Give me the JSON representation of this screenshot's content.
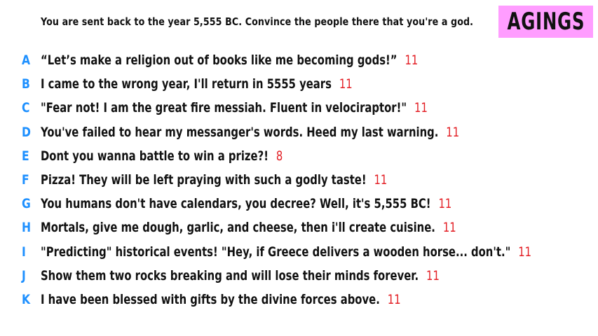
{
  "prompt": "You are sent back to the year 5,555 BC. Convince the people there that you're a god.",
  "badge": "AGINGS",
  "colors": {
    "badge_bg": "#ff9dff",
    "letter": "#1e90ff",
    "score": "#e31e24",
    "text": "#111111"
  },
  "answers": [
    {
      "letter": "A",
      "text": "“Let’s make a religion out of books like me becoming gods!”",
      "score": "11"
    },
    {
      "letter": "B",
      "text": "I came to the wrong year, I'll return in 5555 years",
      "score": "11"
    },
    {
      "letter": "C",
      "text": "\"Fear not! I am the great fire messiah. Fluent in velociraptor!\"",
      "score": "11"
    },
    {
      "letter": "D",
      "text": "You've failed to hear my messanger's words. Heed my last warning.",
      "score": "11"
    },
    {
      "letter": "E",
      "text": "Dont you wanna battle to win a prize?!",
      "score": "8"
    },
    {
      "letter": "F",
      "text": "Pizza! They will be left praying with such a godly taste!",
      "score": "11"
    },
    {
      "letter": "G",
      "text": "You humans don't have calendars, you decree? Well, it's 5,555 BC!",
      "score": "11"
    },
    {
      "letter": "H",
      "text": "Mortals, give me dough, garlic, and cheese, then i'll create cuisine.",
      "score": "11"
    },
    {
      "letter": "I",
      "text": "\"Predicting\" historical events! \"Hey, if Greece delivers a wooden horse... don't.\"",
      "score": "11"
    },
    {
      "letter": "J",
      "text": "Show them two rocks breaking and will lose their minds forever.",
      "score": "11"
    },
    {
      "letter": "K",
      "text": "I have been blessed with gifts by the divine forces above.",
      "score": "11"
    }
  ]
}
